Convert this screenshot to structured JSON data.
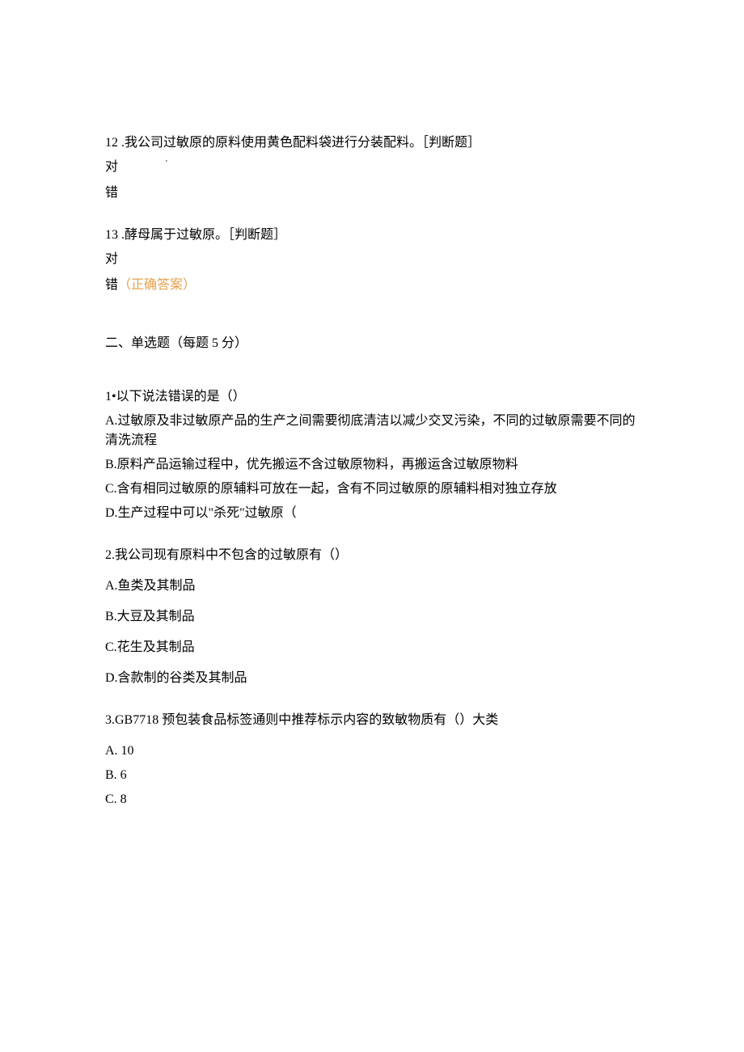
{
  "q12": {
    "number": "12",
    "text": ".我公司过敏原的原料使用黄色配料袋进行分装配料。［判断题］",
    "opt_true": "对",
    "tick": "'",
    "opt_false": "错"
  },
  "q13": {
    "number": "13",
    "text": ".酵母属于过敏原。［判断题］",
    "opt_true": "对",
    "opt_false": "错",
    "correct_suffix": "（正确答案）"
  },
  "section2": {
    "heading": "二、单选题（每题 5 分）"
  },
  "mc1": {
    "stem": "1•以下说法错误的是（）",
    "A": "A.过敏原及非过敏原产品的生产之间需要彻底清洁以减少交叉污染，不同的过敏原需要不同的清洗流程",
    "B": "B.原料产品运输过程中，优先搬运不含过敏原物料，再搬运含过敏原物料",
    "C": "C.含有相同过敏原的原辅料可放在一起，含有不同过敏原的原辅料相对独立存放",
    "D": "D.生产过程中可以\"杀死\"过敏原（"
  },
  "mc2": {
    "stem": "2.我公司现有原料中不包含的过敏原有（）",
    "A": "A.鱼类及其制品",
    "B": "B.大豆及其制品",
    "C": "C.花生及其制品",
    "D": "D.含款制的谷类及其制品"
  },
  "mc3": {
    "stem": "3.GB7718 预包装食品标签通则中推荐标示内容的致敏物质有（）大类",
    "A": "A.   10",
    "B": "B.   6",
    "C": "C.   8"
  }
}
